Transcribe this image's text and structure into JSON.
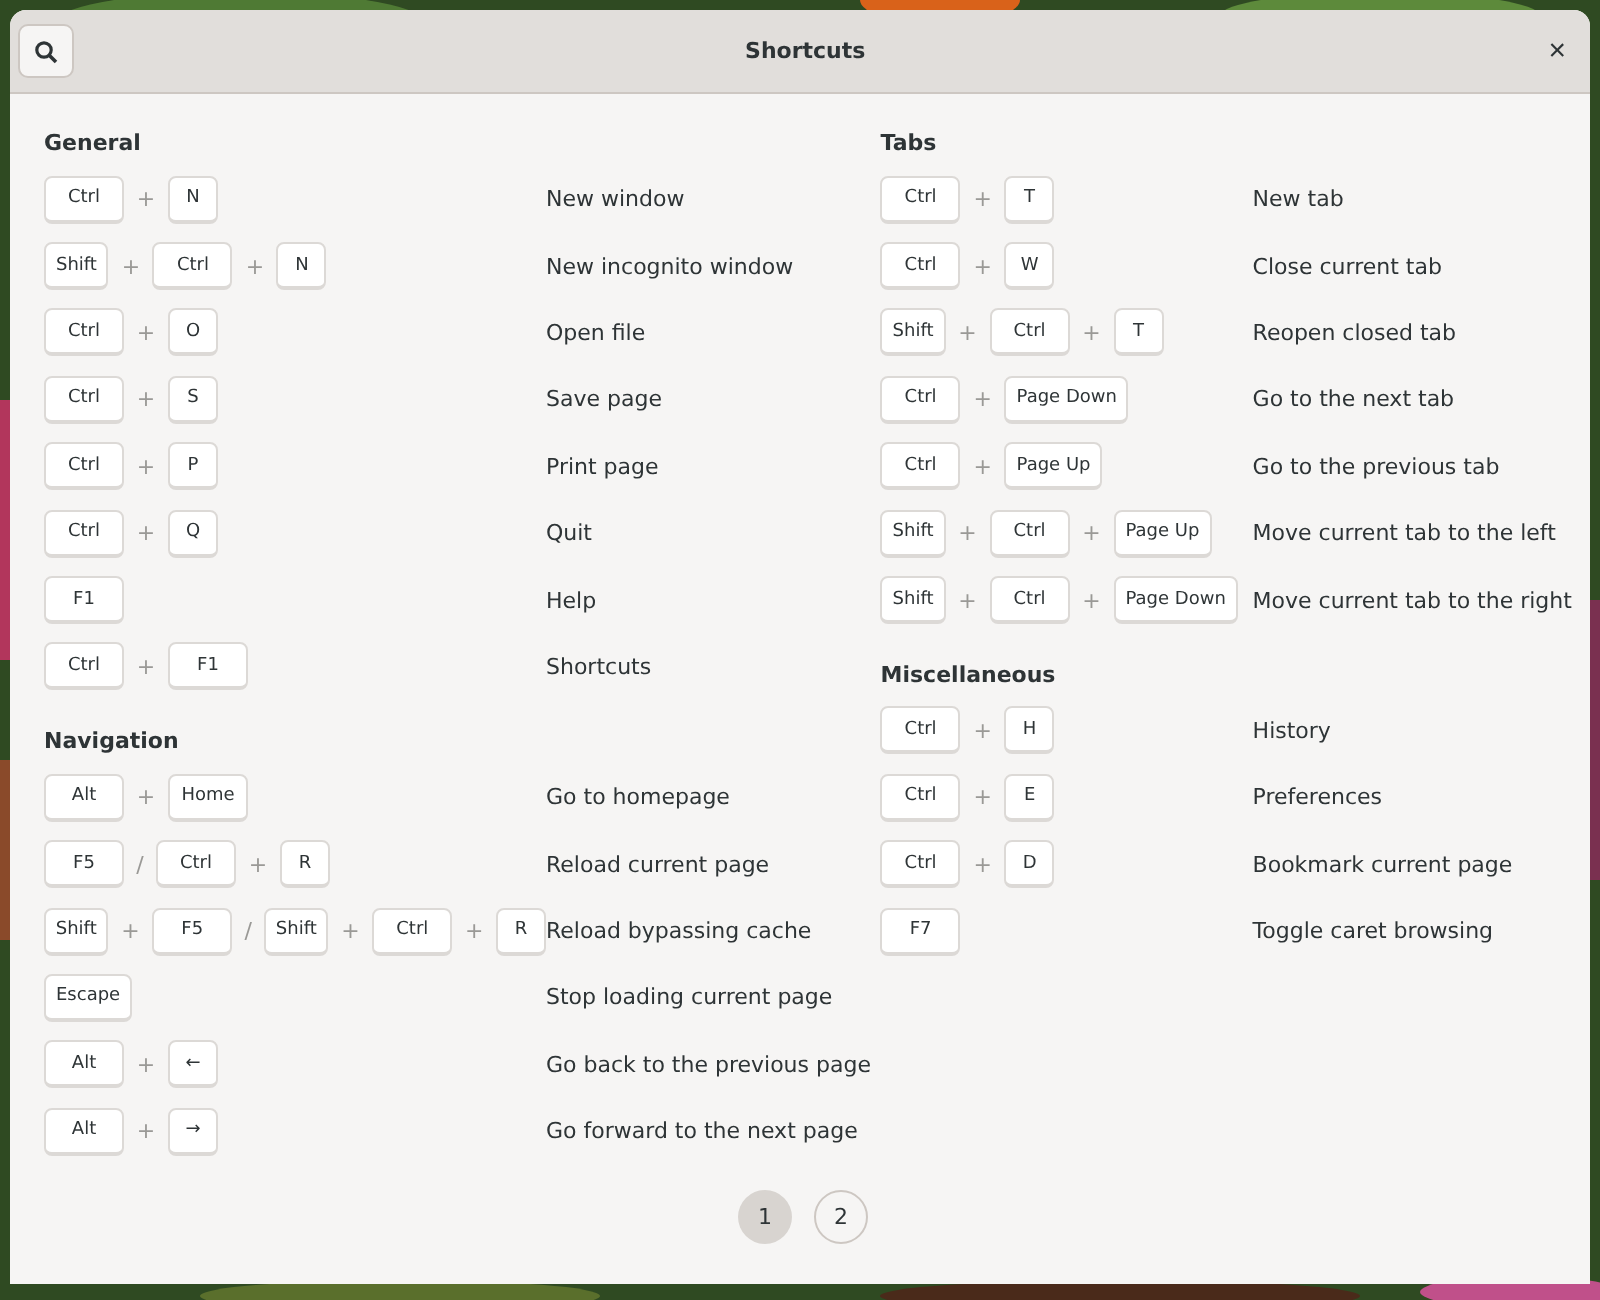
{
  "window": {
    "title": "Shortcuts",
    "close": "×"
  },
  "columns": [
    {
      "groups": [
        {
          "title": "General",
          "shortcuts": [
            {
              "keys": [
                {
                  "kind": "key",
                  "text": "Ctrl"
                },
                {
                  "kind": "plus",
                  "text": "+"
                },
                {
                  "kind": "key",
                  "text": "N"
                }
              ],
              "action": "New window"
            },
            {
              "keys": [
                {
                  "kind": "key",
                  "text": "Shift"
                },
                {
                  "kind": "plus",
                  "text": "+"
                },
                {
                  "kind": "key",
                  "text": "Ctrl"
                },
                {
                  "kind": "plus",
                  "text": "+"
                },
                {
                  "kind": "key",
                  "text": "N"
                }
              ],
              "action": "New incognito window"
            },
            {
              "keys": [
                {
                  "kind": "key",
                  "text": "Ctrl"
                },
                {
                  "kind": "plus",
                  "text": "+"
                },
                {
                  "kind": "key",
                  "text": "O"
                }
              ],
              "action": "Open file"
            },
            {
              "keys": [
                {
                  "kind": "key",
                  "text": "Ctrl"
                },
                {
                  "kind": "plus",
                  "text": "+"
                },
                {
                  "kind": "key",
                  "text": "S"
                }
              ],
              "action": "Save page"
            },
            {
              "keys": [
                {
                  "kind": "key",
                  "text": "Ctrl"
                },
                {
                  "kind": "plus",
                  "text": "+"
                },
                {
                  "kind": "key",
                  "text": "P"
                }
              ],
              "action": "Print page"
            },
            {
              "keys": [
                {
                  "kind": "key",
                  "text": "Ctrl"
                },
                {
                  "kind": "plus",
                  "text": "+"
                },
                {
                  "kind": "key",
                  "text": "Q"
                }
              ],
              "action": "Quit"
            },
            {
              "keys": [
                {
                  "kind": "key",
                  "text": "F1"
                }
              ],
              "action": "Help"
            },
            {
              "keys": [
                {
                  "kind": "key",
                  "text": "Ctrl"
                },
                {
                  "kind": "plus",
                  "text": "+"
                },
                {
                  "kind": "key",
                  "text": "F1"
                }
              ],
              "action": "Shortcuts"
            }
          ]
        },
        {
          "title": "Navigation",
          "shortcuts": [
            {
              "keys": [
                {
                  "kind": "key",
                  "text": "Alt"
                },
                {
                  "kind": "plus",
                  "text": "+"
                },
                {
                  "kind": "key",
                  "text": "Home"
                }
              ],
              "action": "Go to homepage"
            },
            {
              "keys": [
                {
                  "kind": "key",
                  "text": "F5"
                },
                {
                  "kind": "slash",
                  "text": "/"
                },
                {
                  "kind": "key",
                  "text": "Ctrl"
                },
                {
                  "kind": "plus",
                  "text": "+"
                },
                {
                  "kind": "key",
                  "text": "R"
                }
              ],
              "action": "Reload current page"
            },
            {
              "keys": [
                {
                  "kind": "key",
                  "text": "Shift"
                },
                {
                  "kind": "plus",
                  "text": "+"
                },
                {
                  "kind": "key",
                  "text": "F5"
                },
                {
                  "kind": "slash",
                  "text": "/"
                },
                {
                  "kind": "key",
                  "text": "Shift"
                },
                {
                  "kind": "plus",
                  "text": "+"
                },
                {
                  "kind": "key",
                  "text": "Ctrl"
                },
                {
                  "kind": "plus",
                  "text": "+"
                },
                {
                  "kind": "key",
                  "text": "R"
                }
              ],
              "action": "Reload bypassing cache"
            },
            {
              "keys": [
                {
                  "kind": "key",
                  "text": "Escape"
                }
              ],
              "action": "Stop loading current page"
            },
            {
              "keys": [
                {
                  "kind": "key",
                  "text": "Alt"
                },
                {
                  "kind": "plus",
                  "text": "+"
                },
                {
                  "kind": "key",
                  "text": "←"
                }
              ],
              "action": "Go back to the previous page"
            },
            {
              "keys": [
                {
                  "kind": "key",
                  "text": "Alt"
                },
                {
                  "kind": "plus",
                  "text": "+"
                },
                {
                  "kind": "key",
                  "text": "→"
                }
              ],
              "action": "Go forward to the next page"
            }
          ]
        }
      ]
    },
    {
      "groups": [
        {
          "title": "Tabs",
          "shortcuts": [
            {
              "keys": [
                {
                  "kind": "key",
                  "text": "Ctrl"
                },
                {
                  "kind": "plus",
                  "text": "+"
                },
                {
                  "kind": "key",
                  "text": "T"
                }
              ],
              "action": "New tab"
            },
            {
              "keys": [
                {
                  "kind": "key",
                  "text": "Ctrl"
                },
                {
                  "kind": "plus",
                  "text": "+"
                },
                {
                  "kind": "key",
                  "text": "W"
                }
              ],
              "action": "Close current tab"
            },
            {
              "keys": [
                {
                  "kind": "key",
                  "text": "Shift"
                },
                {
                  "kind": "plus",
                  "text": "+"
                },
                {
                  "kind": "key",
                  "text": "Ctrl"
                },
                {
                  "kind": "plus",
                  "text": "+"
                },
                {
                  "kind": "key",
                  "text": "T"
                }
              ],
              "action": "Reopen closed tab"
            },
            {
              "keys": [
                {
                  "kind": "key",
                  "text": "Ctrl"
                },
                {
                  "kind": "plus",
                  "text": "+"
                },
                {
                  "kind": "key",
                  "text": "Page Down"
                }
              ],
              "action": "Go to the next tab"
            },
            {
              "keys": [
                {
                  "kind": "key",
                  "text": "Ctrl"
                },
                {
                  "kind": "plus",
                  "text": "+"
                },
                {
                  "kind": "key",
                  "text": "Page Up"
                }
              ],
              "action": "Go to the previous tab"
            },
            {
              "keys": [
                {
                  "kind": "key",
                  "text": "Shift"
                },
                {
                  "kind": "plus",
                  "text": "+"
                },
                {
                  "kind": "key",
                  "text": "Ctrl"
                },
                {
                  "kind": "plus",
                  "text": "+"
                },
                {
                  "kind": "key",
                  "text": "Page Up"
                }
              ],
              "action": "Move current tab to the left"
            },
            {
              "keys": [
                {
                  "kind": "key",
                  "text": "Shift"
                },
                {
                  "kind": "plus",
                  "text": "+"
                },
                {
                  "kind": "key",
                  "text": "Ctrl"
                },
                {
                  "kind": "plus",
                  "text": "+"
                },
                {
                  "kind": "key",
                  "text": "Page Down"
                }
              ],
              "action": "Move current tab to the right"
            }
          ]
        },
        {
          "title": "Miscellaneous",
          "shortcuts": [
            {
              "keys": [
                {
                  "kind": "key",
                  "text": "Ctrl"
                },
                {
                  "kind": "plus",
                  "text": "+"
                },
                {
                  "kind": "key",
                  "text": "H"
                }
              ],
              "action": "History"
            },
            {
              "keys": [
                {
                  "kind": "key",
                  "text": "Ctrl"
                },
                {
                  "kind": "plus",
                  "text": "+"
                },
                {
                  "kind": "key",
                  "text": "E"
                }
              ],
              "action": "Preferences"
            },
            {
              "keys": [
                {
                  "kind": "key",
                  "text": "Ctrl"
                },
                {
                  "kind": "plus",
                  "text": "+"
                },
                {
                  "kind": "key",
                  "text": "D"
                }
              ],
              "action": "Bookmark current page"
            },
            {
              "keys": [
                {
                  "kind": "key",
                  "text": "F7"
                }
              ],
              "action": "Toggle caret browsing"
            }
          ]
        }
      ]
    }
  ],
  "pages": [
    {
      "label": "1",
      "selected": true
    },
    {
      "label": "2",
      "selected": false
    }
  ]
}
